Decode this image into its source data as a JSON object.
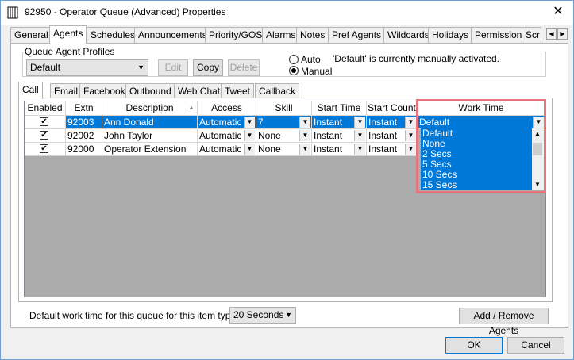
{
  "window": {
    "title": "92950 - Operator Queue (Advanced) Properties",
    "close_glyph": "✕"
  },
  "top_tabs": [
    "General",
    "Agents",
    "Schedules",
    "Announcements",
    "Priority/GOS",
    "Alarms",
    "Notes",
    "Pref Agents",
    "Wildcards",
    "Holidays",
    "Permissions",
    "Scr"
  ],
  "active_top_tab": "Agents",
  "profiles": {
    "group_label": "Queue Agent Profiles",
    "selected": "Default",
    "edit_label": "Edit",
    "copy_label": "Copy",
    "delete_label": "Delete",
    "auto_label": "Auto",
    "manual_label": "Manual",
    "selected_mode": "Manual",
    "status_text": "'Default' is currently manually activated."
  },
  "item_tabs": [
    "Call",
    "Email",
    "Facebook",
    "Outbound",
    "Web Chat",
    "Tweet",
    "Callback"
  ],
  "active_item_tab": "Call",
  "table": {
    "headers": [
      "Enabled",
      "Extn",
      "Description",
      "Access",
      "Skill",
      "Start Time",
      "Start Count",
      "Work Time"
    ],
    "rows": [
      {
        "enabled": true,
        "extn": "92003",
        "description": "Ann Donald",
        "access": "Automatic",
        "skill": "7",
        "start_time": "Instant",
        "start_count": "Instant",
        "work_time": "Default"
      },
      {
        "enabled": true,
        "extn": "92002",
        "description": "John Taylor",
        "access": "Automatic",
        "skill": "None",
        "start_time": "Instant",
        "start_count": "Instant",
        "work_time": ""
      },
      {
        "enabled": true,
        "extn": "92000",
        "description": "Operator Extension",
        "access": "Automatic",
        "skill": "None",
        "start_time": "Instant",
        "start_count": "Instant",
        "work_time": ""
      }
    ],
    "worktime_options": [
      "Default",
      "None",
      "2 Secs",
      "5 Secs",
      "10 Secs",
      "15 Secs"
    ]
  },
  "footer": {
    "worktime_label": "Default work time for this queue for this item type:",
    "worktime_value": "20 Seconds",
    "add_remove_label": "Add / Remove Agents",
    "ok_label": "OK",
    "cancel_label": "Cancel"
  },
  "colors": {
    "selection": "#0078d7",
    "highlight": "#e8737c"
  }
}
